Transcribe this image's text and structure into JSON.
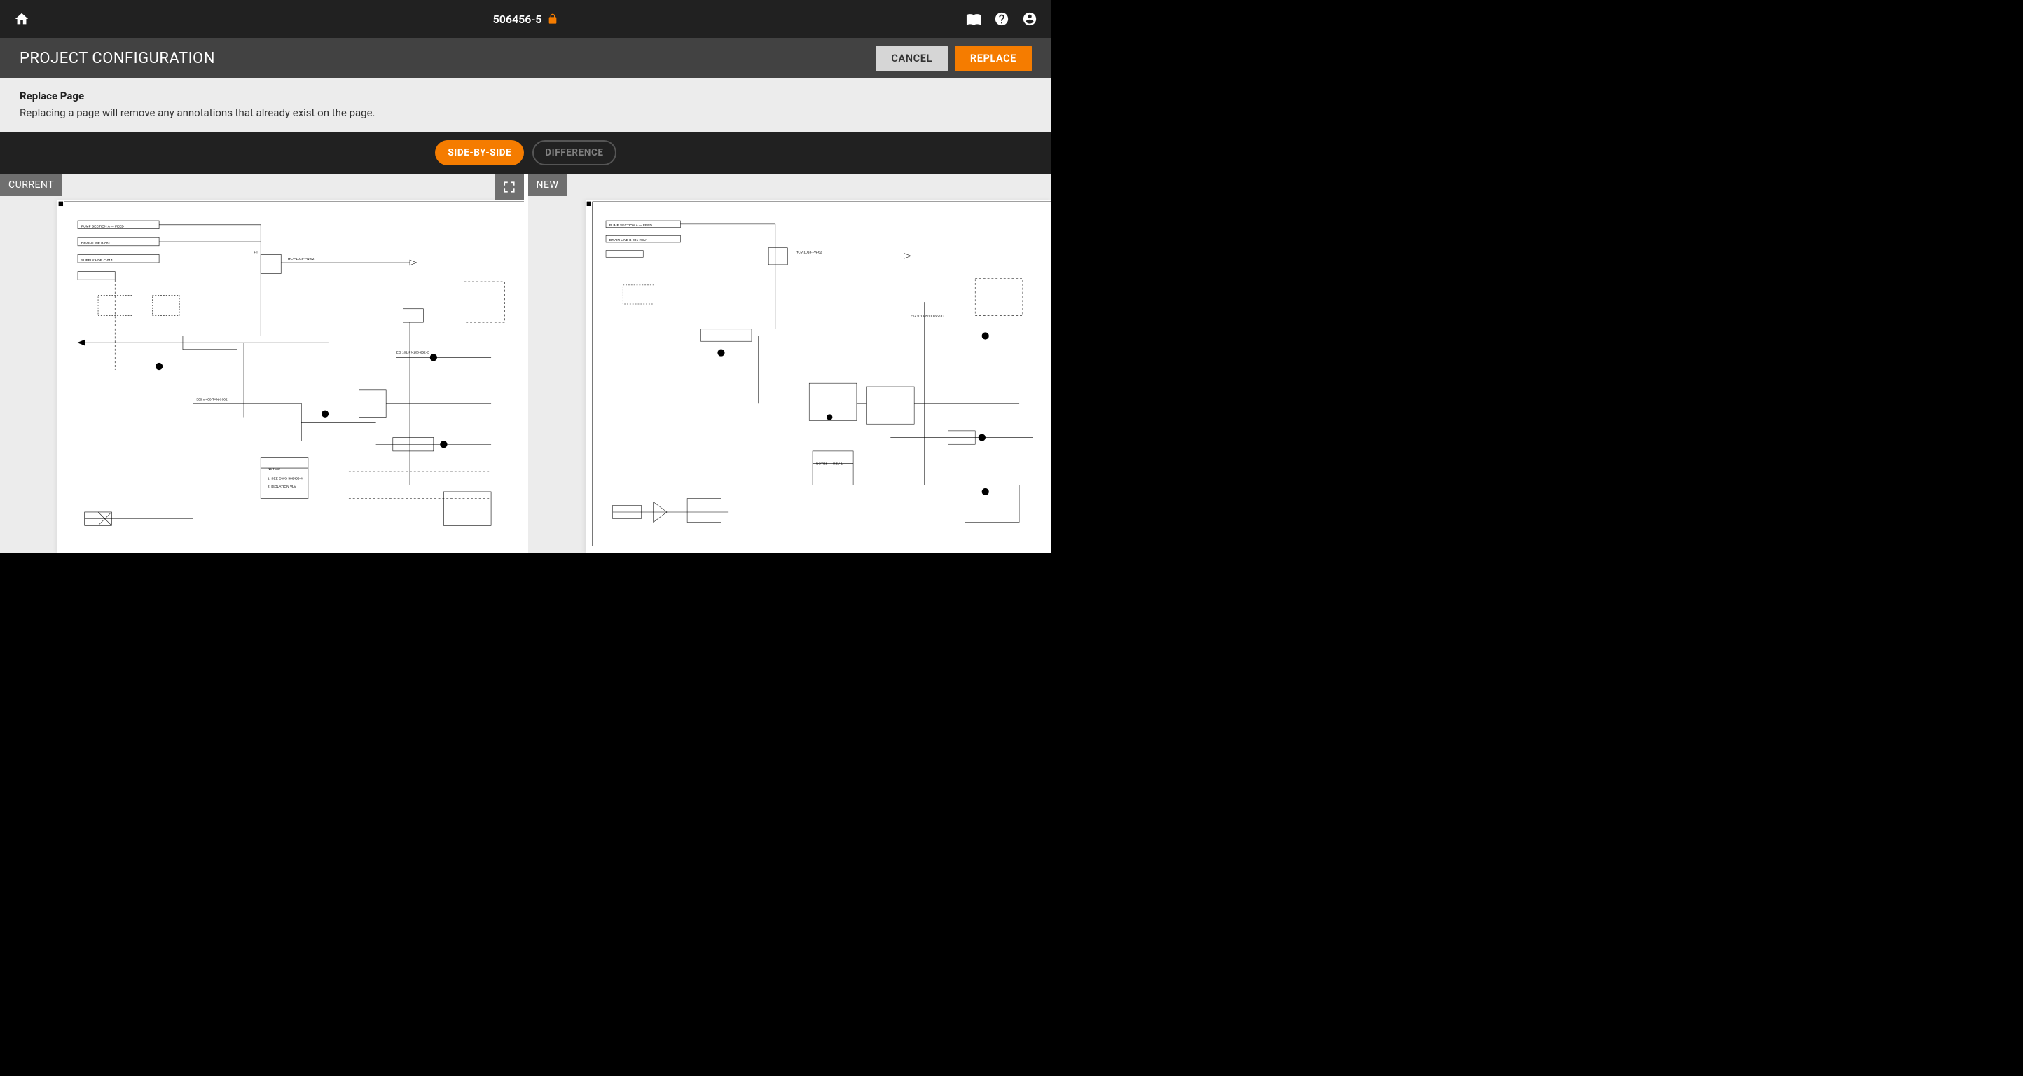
{
  "topbar": {
    "project_id": "506456-5"
  },
  "titlebar": {
    "title": "PROJECT CONFIGURATION",
    "cancel_label": "CANCEL",
    "replace_label": "REPLACE"
  },
  "info": {
    "title": "Replace Page",
    "body": "Replacing a page will remove any annotations that already exist on the page."
  },
  "toggle": {
    "side_by_side": "SIDE-BY-SIDE",
    "difference": "DIFFERENCE",
    "active": "side_by_side"
  },
  "panes": {
    "current_label": "CURRENT",
    "new_label": "NEW"
  }
}
